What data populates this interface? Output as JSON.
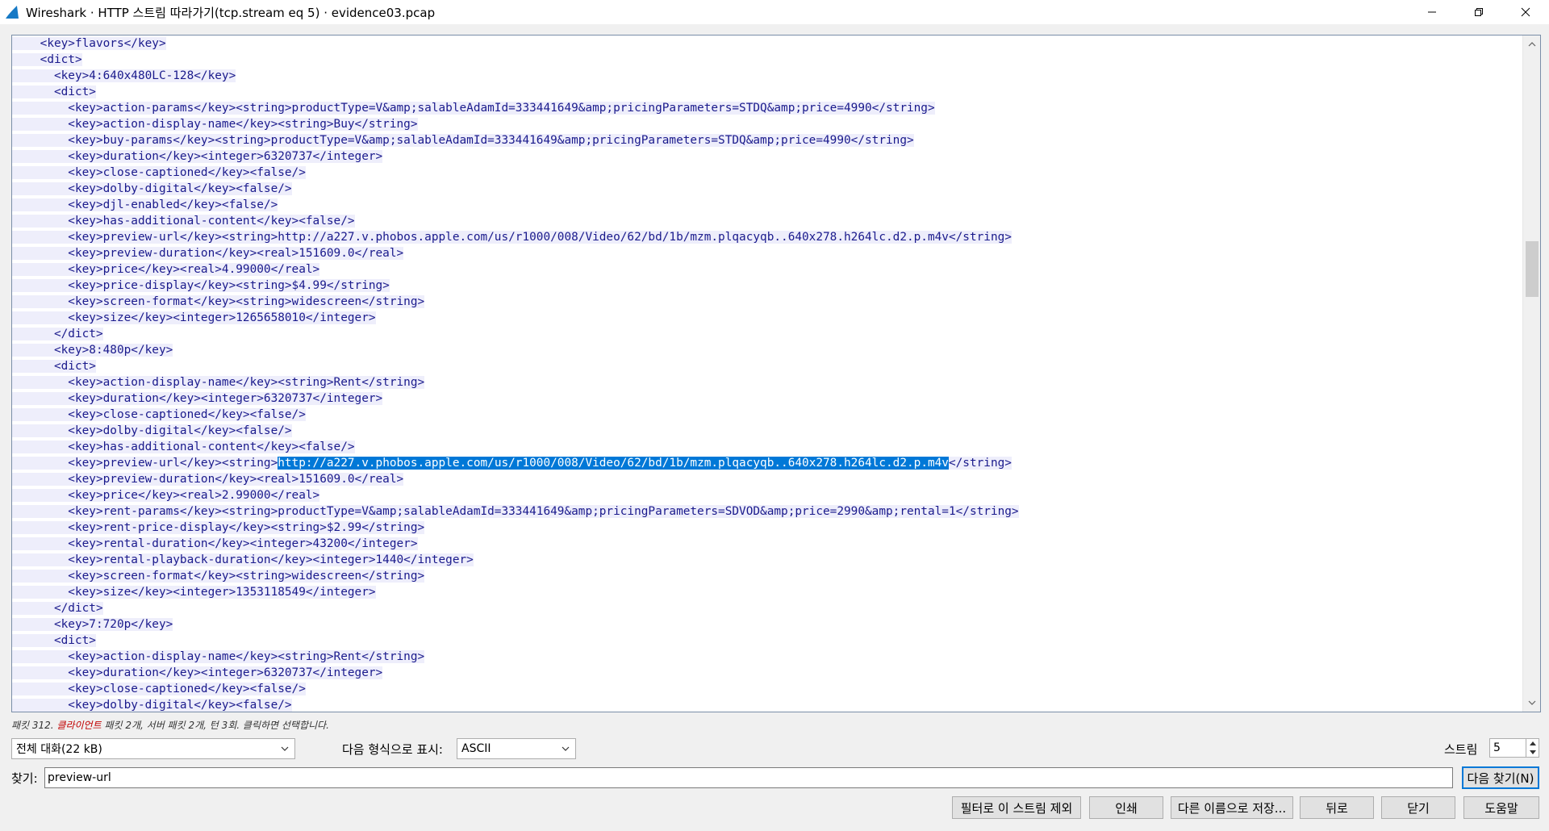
{
  "window": {
    "title": "Wireshark · HTTP 스트림 따라가기(tcp.stream eq 5) · evidence03.pcap",
    "icons": {
      "app": "wireshark-fin-icon",
      "minimize": "minimize-icon",
      "restore": "restore-icon",
      "close": "close-icon"
    },
    "accent_color": "#0078d7"
  },
  "stream": {
    "lines": [
      "    <key>flavors</key>",
      "    <dict>",
      "      <key>4:640x480LC-128</key>",
      "      <dict>",
      "        <key>action-params</key><string>productType=V&amp;salableAdamId=333441649&amp;pricingParameters=STDQ&amp;price=4990</string>",
      "        <key>action-display-name</key><string>Buy</string>",
      "        <key>buy-params</key><string>productType=V&amp;salableAdamId=333441649&amp;pricingParameters=STDQ&amp;price=4990</string>",
      "        <key>duration</key><integer>6320737</integer>",
      "        <key>close-captioned</key><false/>",
      "        <key>dolby-digital</key><false/>",
      "        <key>djl-enabled</key><false/>",
      "        <key>has-additional-content</key><false/>",
      "        <key>preview-url</key><string>http://a227.v.phobos.apple.com/us/r1000/008/Video/62/bd/1b/mzm.plqacyqb..640x278.h264lc.d2.p.m4v</string>",
      "        <key>preview-duration</key><real>151609.0</real>",
      "        <key>price</key><real>4.99000</real>",
      "        <key>price-display</key><string>$4.99</string>",
      "        <key>screen-format</key><string>widescreen</string>",
      "        <key>size</key><integer>1265658010</integer>",
      "      </dict>",
      "      <key>8:480p</key>",
      "      <dict>",
      "        <key>action-display-name</key><string>Rent</string>",
      "        <key>duration</key><integer>6320737</integer>",
      "        <key>close-captioned</key><false/>",
      "        <key>dolby-digital</key><false/>",
      "        <key>has-additional-content</key><false/>",
      "        <key>preview-url</key><string>http://a227.v.phobos.apple.com/us/r1000/008/Video/62/bd/1b/mzm.plqacyqb..640x278.h264lc.d2.p.m4v</string>",
      "        <key>preview-duration</key><real>151609.0</real>",
      "        <key>price</key><real>2.99000</real>",
      "        <key>rent-params</key><string>productType=V&amp;salableAdamId=333441649&amp;pricingParameters=SDVOD&amp;price=2990&amp;rental=1</string>",
      "        <key>rent-price-display</key><string>$2.99</string>",
      "        <key>rental-duration</key><integer>43200</integer>",
      "        <key>rental-playback-duration</key><integer>1440</integer>",
      "        <key>screen-format</key><string>widescreen</string>",
      "        <key>size</key><integer>1353118549</integer>",
      "      </dict>",
      "      <key>7:720p</key>",
      "      <dict>",
      "        <key>action-display-name</key><string>Rent</string>",
      "        <key>duration</key><integer>6320737</integer>",
      "        <key>close-captioned</key><false/>",
      "        <key>dolby-digital</key><false/>"
    ],
    "selected_line_index": 26,
    "selected_text": "http://a227.v.phobos.apple.com/us/r1000/008/Video/62/bd/1b/mzm.plqacyqb..640x278.h264lc.d2.p.m4v",
    "text_color": "#1a1a8c",
    "text_background": "#eeeefb",
    "scroll_icons": {
      "up": "chevron-up-icon",
      "down": "chevron-down-icon"
    }
  },
  "status": {
    "prefix": "패킷 312. ",
    "client": "클라이언트",
    "suffix": " 패킷 2개, 서버 패킷 2개, 턴 3회. 클릭하면 선택합니다."
  },
  "controls": {
    "conversation_select": "전체 대화(22 kB)",
    "show_as_label": "다음 형식으로 표시:",
    "format_select": "ASCII",
    "stream_label": "스트림",
    "stream_number": "5",
    "find_label": "찾기:",
    "find_value": "preview-url",
    "find_next_button": "다음 찾기(N)"
  },
  "buttons": {
    "filter_out": "필터로 이 스트림 제외",
    "print": "인쇄",
    "save_as": "다른 이름으로 저장...",
    "back": "뒤로",
    "close": "닫기",
    "help": "도움말"
  }
}
